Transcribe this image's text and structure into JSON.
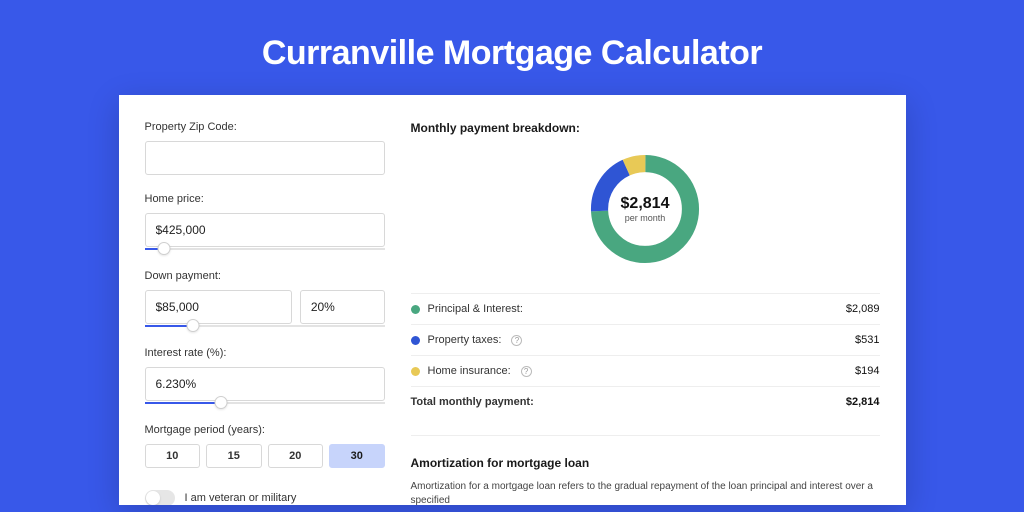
{
  "page_title": "Curranville Mortgage Calculator",
  "form": {
    "zip_label": "Property Zip Code:",
    "zip_value": "",
    "home_price_label": "Home price:",
    "home_price_value": "$425,000",
    "home_price_slider_pct": 8,
    "down_payment_label": "Down payment:",
    "down_payment_value": "$85,000",
    "down_payment_pct_value": "20%",
    "down_payment_slider_pct": 20,
    "interest_label": "Interest rate (%):",
    "interest_value": "6.230%",
    "interest_slider_pct": 32,
    "period_label": "Mortgage period (years):",
    "periods": [
      "10",
      "15",
      "20",
      "30"
    ],
    "period_active_index": 3,
    "veteran_label": "I am veteran or military"
  },
  "breakdown": {
    "title": "Monthly payment breakdown:",
    "center_amount": "$2,814",
    "center_sub": "per month",
    "items": [
      {
        "label": "Principal & Interest:",
        "value": "$2,089",
        "color": "green",
        "info": false
      },
      {
        "label": "Property taxes:",
        "value": "$531",
        "color": "blue",
        "info": true
      },
      {
        "label": "Home insurance:",
        "value": "$194",
        "color": "yellow",
        "info": true
      }
    ],
    "total_label": "Total monthly payment:",
    "total_value": "$2,814"
  },
  "amortization": {
    "title": "Amortization for mortgage loan",
    "text": "Amortization for a mortgage loan refers to the gradual repayment of the loan principal and interest over a specified"
  },
  "chart_data": {
    "type": "pie",
    "title": "Monthly payment breakdown",
    "series": [
      {
        "name": "Principal & Interest",
        "value": 2089
      },
      {
        "name": "Property taxes",
        "value": 531
      },
      {
        "name": "Home insurance",
        "value": 194
      }
    ],
    "total": 2814,
    "unit": "USD/month"
  }
}
